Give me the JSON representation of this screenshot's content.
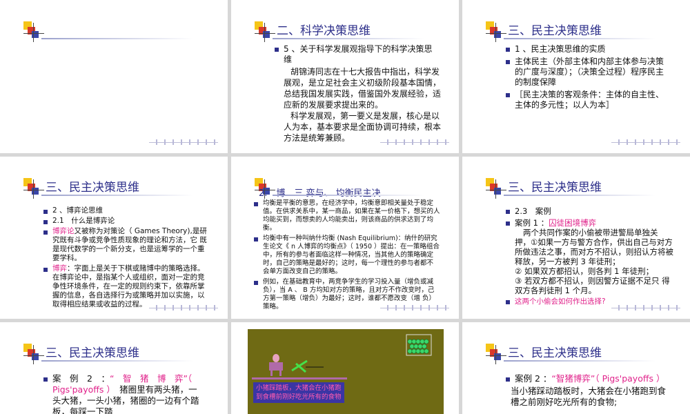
{
  "slides": {
    "s1": {
      "title": ""
    },
    "s2": {
      "title": "二、科学决策思维",
      "bullet": "5 、关于科学发展观指导下的科学决策思 维",
      "p1": "胡锦涛同志在十七大报告中指出，科学发展观，是立足社会主义初级阶段基本国情，总结我国发展实践，借鉴国外发展经验，适应新的发展要求提出来的。",
      "p2": "科学发展观，第一要义是发展，核心是以人为本，基本要求是全面协调可持续，根本方法是统筹兼顾。"
    },
    "s3": {
      "title": "三、民主决策思维",
      "b1": "1 、民主决策思维的实质",
      "b2": "主体民主（外部主体和内部主体参与决策的广度与深度）；（决策全过程）程序民主的制度保障",
      "b3": "［民主决策的客观条件：主体的自主性、主体的多元性；以人为本］"
    },
    "s4": {
      "title": "三、民主决策思维",
      "b1": "2 、博弈论思维",
      "b2": "2.1　什么是博弈论",
      "b3_key": "博弈论",
      "b3_rest": "又被称为对策论（ Games Theory),是研 究既有斗争或竞争性质现象的理论和方法，它 既是现代数学的一个新分支，也是运筹学的一个重要学科。",
      "b4_key": "博弈",
      "b4_rest": "：字面上是关于下棋或赌博中的策略选择。在博弈论中，是指某个人或组织，面对一定的竞争性环境条件，在一定的规则约束下，依靠所掌握的信息，各自选择行为或策略并加以实施，以取得相应结果或收益的过程。"
    },
    "s5": {
      "title_overlap": "2.　博　三 弈与、 均衡民主决",
      "b1": "均衡是平衡的意思，在经济学中，均衡意即相关量处于稳定值。在供求关系中，某一商品，如果在某一价格下，想买的人均能买到，而想卖的人均能卖出，则该商品的供求达到了均衡。",
      "b2": "均衡中有一种叫纳什均衡 (Nash Equilibrium)：纳什的研究 生论文《 n 人博弈的均衡点》（ 1950 ）提出：在一策略组合 中，所有的参与者面临这样一种情况，当其他人的策略确定 时，自己的策略是最好的；这时，每一个理性的参与者都不 会单方面改变自己的策略。",
      "b3": "例如，在基础教育中，两竞争学生的学习投入量（增负或减 负），当 A 、 B 方均知对方的策略，且对方不作改变时，己 方第一策略（增负）为最好；这时，谁都不愿改变（增 负）策略。"
    },
    "s6": {
      "title": "三、民主决策思维",
      "b1": "2.3　案例",
      "b2_label": "案例 1 ：",
      "b2_key": "囚徒困境博弈",
      "p1": "两个共同作案的小偷被带进警局单独关押，①如果一方与警方合作，供出自己与对方所做违法之事，而对方不招认，则招认方将被释放，另一方被判 3 年徒刑；",
      "p2": "② 如果双方都招认，则各判 1 年徒刑；",
      "p3": "③ 若双方都不招认，则因警方证据不足只 得双方各判徒刑 1 个月。",
      "b3": "这两个小偷会如何作出选择?"
    },
    "s7": {
      "title": "三、民主决策思维",
      "b1_label": "案　例　2　：",
      "b1_key": "“　智　猪　博　弈”（ Pigs'payoffs ）",
      "b1_rest": "猪圈里有两头猪，一头大猪，一头小猪，猪圈的一边有个踏板，每踩一下踏"
    },
    "s8": {
      "caption1": "小猪踩踏板，大猪会在小猪跑",
      "caption2": "到食槽前刚好吃光所有的食物"
    },
    "s9": {
      "title": "三、民主决策思维",
      "b1_label": "案例 2 ：",
      "b1_key": "“智猪博弈”（ Pigs'payoffs ）",
      "p1": "当小猪踩动踏板时，大猪会在小猪跑到食槽之前刚好吃光所有的食物;"
    }
  },
  "colors": {
    "title": "#2d2f8a",
    "accent": "#e0218a",
    "bullet": "#2d2f8a",
    "game_bg": "#6f6a14"
  }
}
